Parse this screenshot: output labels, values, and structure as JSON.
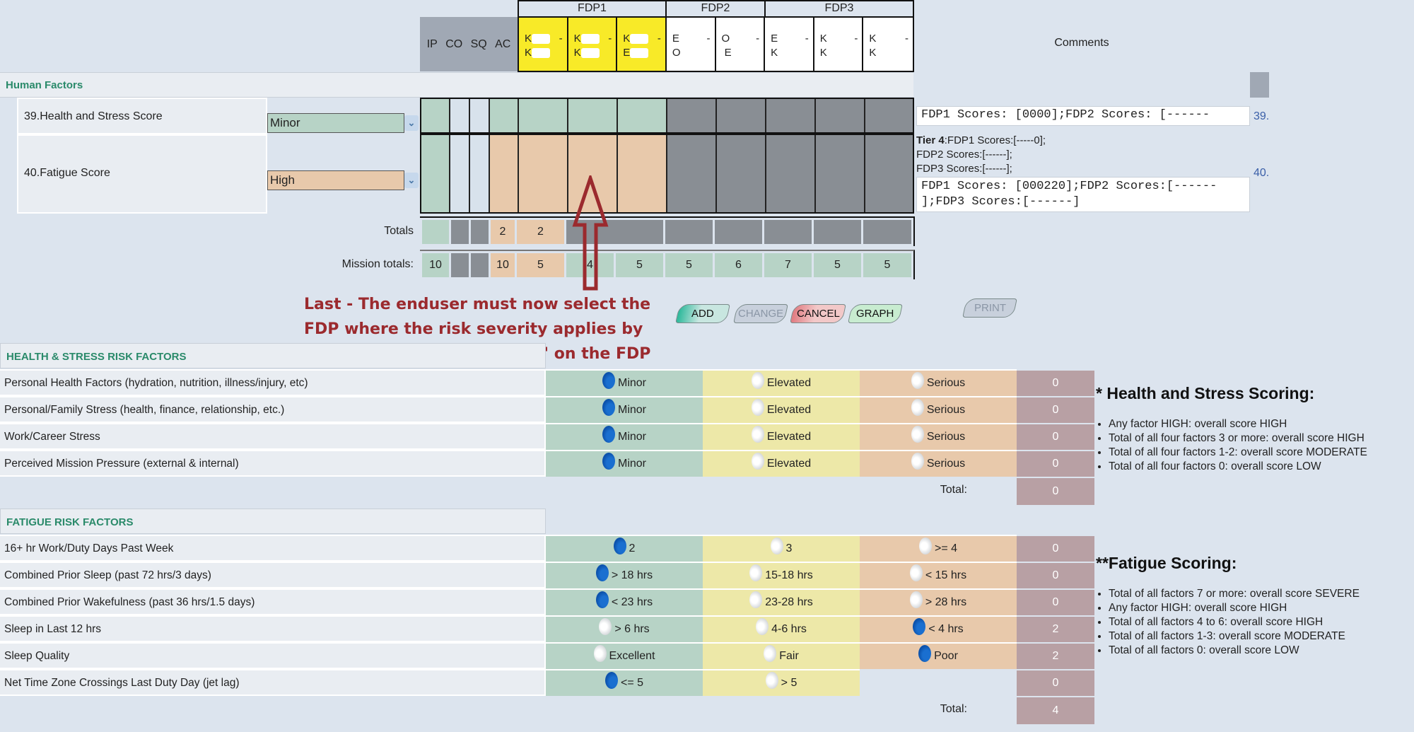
{
  "header": {
    "roles": [
      "IP",
      "CO",
      "SQ",
      "AC"
    ],
    "fdp_groups": [
      {
        "label": "FDP1",
        "cells": [
          {
            "line1": "K",
            "line2": "K"
          },
          {
            "line1": "K",
            "line2": "K"
          },
          {
            "line1": "K",
            "line2": "E"
          }
        ]
      },
      {
        "label": "FDP2",
        "cells": [
          {
            "line1": "E",
            "line2": "O"
          },
          {
            "line1": "O",
            "line2": "E"
          }
        ]
      },
      {
        "label": "FDP3",
        "cells": [
          {
            "line1": "E",
            "line2": "K"
          },
          {
            "line1": "K",
            "line2": "K"
          },
          {
            "line1": "K",
            "line2": "K"
          }
        ]
      }
    ],
    "dash": "-",
    "comments_label": "Comments"
  },
  "human_factors": {
    "title": "Human Factors",
    "rows": [
      {
        "label": "39.Health and Stress Score",
        "select_value": "Minor",
        "row_num": "39.",
        "comment": "FDP1 Scores: [0000];FDP2 Scores: [------"
      },
      {
        "label": "40.Fatigue Score",
        "select_value": "High",
        "row_num": "40.",
        "tier_label": "Tier 4",
        "tier_lines": [
          ":FDP1 Scores:[-----0];",
          "FDP2 Scores:[------];",
          "FDP3 Scores:[------];"
        ],
        "comment_line1": "FDP1 Scores: [000220];FDP2 Scores:[------",
        "comment_line2": "];FDP3 Scores:[------]"
      }
    ],
    "totals_label": "Totals",
    "totals": [
      "",
      "",
      "",
      "2",
      "2",
      "",
      "",
      "",
      "",
      "",
      ""
    ],
    "mission_totals_label": "Mission totals:",
    "mission_totals": [
      "10",
      "",
      "",
      "10",
      "5",
      "4",
      "5",
      "5",
      "6",
      "7",
      "5",
      "5"
    ]
  },
  "instruction": "Last - The enduser must now select the FDP where the risk severity applies by using the mouse and \"click\" on the FDP",
  "buttons": {
    "add": "ADD",
    "change": "CHANGE",
    "cancel": "CANCEL",
    "graph": "GRAPH",
    "print": "PRINT"
  },
  "health_stress": {
    "title": "HEALTH & STRESS RISK FACTORS",
    "rows": [
      {
        "label": "Personal Health Factors (hydration, nutrition, illness/injury, etc)",
        "options": [
          "Minor",
          "Elevated",
          "Serious"
        ],
        "selected": 0,
        "score": "0"
      },
      {
        "label": "Personal/Family Stress (health, finance, relationship, etc.)",
        "options": [
          "Minor",
          "Elevated",
          "Serious"
        ],
        "selected": 0,
        "score": "0"
      },
      {
        "label": "Work/Career Stress",
        "options": [
          "Minor",
          "Elevated",
          "Serious"
        ],
        "selected": 0,
        "score": "0"
      },
      {
        "label": "Perceived Mission Pressure (external & internal)",
        "options": [
          "Minor",
          "Elevated",
          "Serious"
        ],
        "selected": 0,
        "score": "0"
      }
    ],
    "total_label": "Total:",
    "total": "0",
    "scoring_title": "* Health and Stress Scoring:",
    "scoring_rules": [
      "Any factor HIGH: overall score HIGH",
      "Total of all four factors 3 or more: overall score HIGH",
      "Total of all four factors 1-2: overall score MODERATE",
      "Total of all four factors 0: overall score LOW"
    ]
  },
  "fatigue": {
    "title": "FATIGUE RISK FACTORS",
    "rows": [
      {
        "label": "16+ hr Work/Duty Days Past Week",
        "options": [
          "2",
          "3",
          ">= 4"
        ],
        "selected": 0,
        "score": "0"
      },
      {
        "label": "Combined Prior Sleep (past 72 hrs/3 days)",
        "options": [
          "> 18 hrs",
          "15-18 hrs",
          "< 15 hrs"
        ],
        "selected": 0,
        "score": "0"
      },
      {
        "label": "Combined Prior Wakefulness (past 36 hrs/1.5 days)",
        "options": [
          "< 23 hrs",
          "23-28 hrs",
          "> 28 hrs"
        ],
        "selected": 0,
        "score": "0"
      },
      {
        "label": "Sleep in Last 12 hrs",
        "options": [
          "> 6 hrs",
          "4-6 hrs",
          "< 4 hrs"
        ],
        "selected": 2,
        "score": "2"
      },
      {
        "label": "Sleep Quality",
        "options": [
          "Excellent",
          "Fair",
          "Poor"
        ],
        "selected": 2,
        "score": "2"
      },
      {
        "label": "Net Time Zone Crossings Last Duty Day (jet lag)",
        "options": [
          "<= 5",
          "> 5"
        ],
        "selected": 0,
        "score": "0"
      }
    ],
    "total_label": "Total:",
    "total": "4",
    "scoring_title": "**Fatigue Scoring:",
    "scoring_rules": [
      "Total of all factors 7 or more: overall score SEVERE",
      "Any factor HIGH: overall score HIGH",
      "Total of all factors 4 to 6: overall score HIGH",
      "Total of all factors 1-3: overall score MODERATE",
      "Total of all factors 0: overall score LOW"
    ]
  },
  "colors": {
    "low": "#b7d3c6",
    "moderate": "#ede8a8",
    "high": "#e8c9ab",
    "na": "#898e94",
    "fdp_selected": "#f8ea28",
    "score": "#b8a0a4",
    "section_title": "#2a8a6a",
    "instruction": "#9b2a2e"
  }
}
